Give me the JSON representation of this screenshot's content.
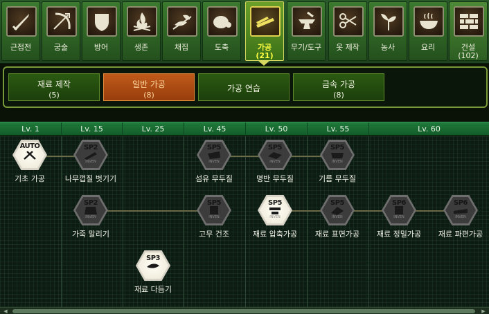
{
  "categories": [
    {
      "label": "근접전",
      "count": "",
      "icon": "sword-icon"
    },
    {
      "label": "궁술",
      "count": "",
      "icon": "bow-icon"
    },
    {
      "label": "방어",
      "count": "",
      "icon": "shield-icon"
    },
    {
      "label": "생존",
      "count": "",
      "icon": "campfire-icon"
    },
    {
      "label": "채집",
      "count": "",
      "icon": "gathering-icon"
    },
    {
      "label": "도축",
      "count": "",
      "icon": "meat-icon"
    },
    {
      "label": "가공",
      "count": "(21)",
      "icon": "plank-icon"
    },
    {
      "label": "무기/도구",
      "count": "",
      "icon": "anvil-icon"
    },
    {
      "label": "옷 제작",
      "count": "",
      "icon": "scissors-icon"
    },
    {
      "label": "농사",
      "count": "",
      "icon": "plant-icon"
    },
    {
      "label": "요리",
      "count": "",
      "icon": "cooking-pot-icon"
    },
    {
      "label": "건설",
      "count": "(102)",
      "icon": "bricks-icon"
    }
  ],
  "active_category": "가공",
  "sub_tabs": [
    {
      "label": "재료 제작",
      "count": "(5)"
    },
    {
      "label": "일반 가공",
      "count": "(8)"
    },
    {
      "label": "가공 연습",
      "count": ""
    },
    {
      "label": "금속 가공",
      "count": "(8)"
    }
  ],
  "active_sub_tab": "일반 가공",
  "levels": [
    "Lv. 1",
    "Lv. 15",
    "Lv. 25",
    "Lv. 45",
    "Lv. 50",
    "Lv. 55",
    "Lv. 60"
  ],
  "skills": [
    {
      "name": "기초 가공",
      "badge": "AUTO",
      "state": "learned",
      "sub": ""
    },
    {
      "name": "나무껍질 벗기기",
      "badge": "SP2",
      "state": "locked",
      "sub": "INVEN"
    },
    {
      "name": "섬유 무두질",
      "badge": "SP5",
      "state": "locked",
      "sub": "INVEN"
    },
    {
      "name": "명반 무두질",
      "badge": "SP5",
      "state": "locked",
      "sub": "INVEN"
    },
    {
      "name": "기름 무두질",
      "badge": "SP5",
      "state": "locked",
      "sub": "INVEN"
    },
    {
      "name": "가죽 말리기",
      "badge": "SP2",
      "state": "locked",
      "sub": "INVEN"
    },
    {
      "name": "고무 건조",
      "badge": "SP5",
      "state": "locked",
      "sub": "INVEN"
    },
    {
      "name": "재료 압축가공",
      "badge": "SP5",
      "state": "learned",
      "sub": "INVEN"
    },
    {
      "name": "재료 표면가공",
      "badge": "SP5",
      "state": "locked",
      "sub": "INVEN"
    },
    {
      "name": "재료 정밀가공",
      "badge": "SP6",
      "state": "locked",
      "sub": "INVEN"
    },
    {
      "name": "재료 파편가공",
      "badge": "SP6",
      "state": "locked",
      "sub": "INVEN"
    },
    {
      "name": "재료 다듬기",
      "badge": "SP3",
      "state": "learned",
      "sub": ""
    }
  ]
}
